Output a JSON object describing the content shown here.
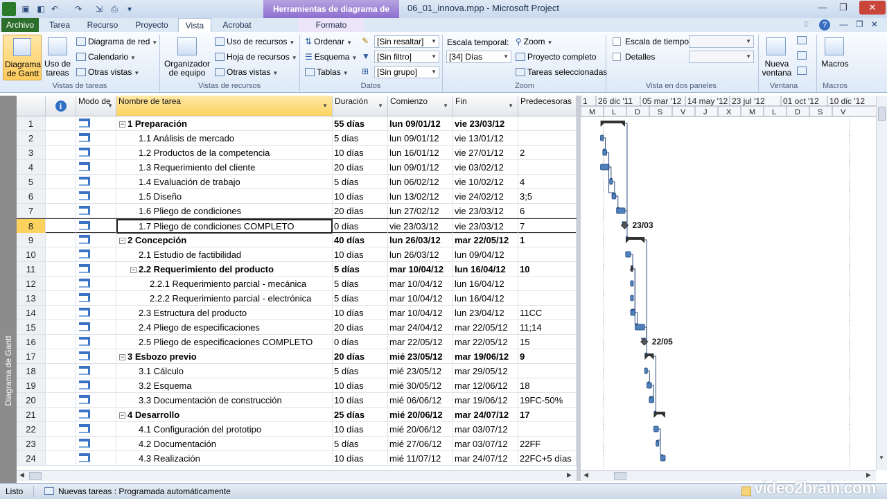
{
  "titlebar": {
    "title": "06_01_innova.mpp  -  Microsoft Project",
    "context_group": "Herramientas de diagrama de Gantt"
  },
  "tabs": [
    "Archivo",
    "Tarea",
    "Recurso",
    "Proyecto",
    "Vista",
    "Acrobat",
    "Formato"
  ],
  "ribbon": {
    "vistas_tareas": {
      "label": "Vistas de tareas",
      "gantt": "Diagrama de Gantt",
      "uso_tareas": "Uso de tareas",
      "diagrama_red": "Diagrama de red",
      "calendario": "Calendario",
      "otras_vistas": "Otras vistas"
    },
    "vistas_recursos": {
      "label": "Vistas de recursos",
      "organizador": "Organizador de equipo",
      "uso_recursos": "Uso de recursos",
      "hoja_recursos": "Hoja de recursos",
      "otras_vistas": "Otras vistas"
    },
    "datos": {
      "label": "Datos",
      "ordenar": "Ordenar",
      "esquema": "Esquema",
      "tablas": "Tablas",
      "resaltar": "[Sin resaltar]",
      "filtro": "[Sin filtro]",
      "grupo": "[Sin grupo]"
    },
    "zoom": {
      "label": "Zoom",
      "escala_label": "Escala temporal:",
      "escala_value": "[34] Días",
      "zoom": "Zoom",
      "proyecto_completo": "Proyecto completo",
      "tareas_seleccionadas": "Tareas seleccionadas"
    },
    "dos_paneles": {
      "label": "Vista en dos paneles",
      "escala_tiempo": "Escala de tiempo",
      "detalles": "Detalles"
    },
    "ventana": {
      "label": "Ventana",
      "nueva_ventana": "Nueva ventana"
    },
    "macros": {
      "label": "Macros",
      "macros": "Macros"
    }
  },
  "sidebar_label": "Diagrama de Gantt",
  "columns": {
    "info": "i",
    "modo": "Modo de",
    "nombre": "Nombre de tarea",
    "duracion": "Duración",
    "comienzo": "Comienzo",
    "fin": "Fin",
    "predecesoras": "Predecesoras"
  },
  "tasks": [
    {
      "id": "1",
      "name": "1 Preparación",
      "dur": "55 días",
      "start": "lun 09/01/12",
      "end": "vie 23/03/12",
      "pred": "",
      "level": 0,
      "summary": true
    },
    {
      "id": "2",
      "name": "1.1 Análisis de mercado",
      "dur": "5 días",
      "start": "lun 09/01/12",
      "end": "vie 13/01/12",
      "pred": "",
      "level": 1,
      "summary": false
    },
    {
      "id": "3",
      "name": "1.2 Productos de la competencia",
      "dur": "10 días",
      "start": "lun 16/01/12",
      "end": "vie 27/01/12",
      "pred": "2",
      "level": 1,
      "summary": false
    },
    {
      "id": "4",
      "name": "1.3 Requerimiento del cliente",
      "dur": "20 días",
      "start": "lun 09/01/12",
      "end": "vie 03/02/12",
      "pred": "",
      "level": 1,
      "summary": false
    },
    {
      "id": "5",
      "name": "1.4 Evaluación de trabajo",
      "dur": "5 días",
      "start": "lun 06/02/12",
      "end": "vie 10/02/12",
      "pred": "4",
      "level": 1,
      "summary": false
    },
    {
      "id": "6",
      "name": "1.5 Diseño",
      "dur": "10 días",
      "start": "lun 13/02/12",
      "end": "vie 24/02/12",
      "pred": "3;5",
      "level": 1,
      "summary": false
    },
    {
      "id": "7",
      "name": "1.6 Pliego de condiciones",
      "dur": "20 días",
      "start": "lun 27/02/12",
      "end": "vie 23/03/12",
      "pred": "6",
      "level": 1,
      "summary": false
    },
    {
      "id": "8",
      "name": "1.7 Pliego de condiciones  COMPLETO",
      "dur": "0 días",
      "start": "vie 23/03/12",
      "end": "vie 23/03/12",
      "pred": "7",
      "level": 1,
      "summary": false,
      "selected": true
    },
    {
      "id": "9",
      "name": "2 Concepción",
      "dur": "40 días",
      "start": "lun 26/03/12",
      "end": "mar 22/05/12",
      "pred": "1",
      "level": 0,
      "summary": true
    },
    {
      "id": "10",
      "name": "2.1 Estudio de factibilidad",
      "dur": "10 días",
      "start": "lun 26/03/12",
      "end": "lun 09/04/12",
      "pred": "",
      "level": 1,
      "summary": false
    },
    {
      "id": "11",
      "name": "2.2 Requerimiento del producto",
      "dur": "5 días",
      "start": "mar 10/04/12",
      "end": "lun 16/04/12",
      "pred": "10",
      "level": 1,
      "summary": true
    },
    {
      "id": "12",
      "name": "2.2.1 Requerimiento parcial - mecánica",
      "dur": "5 días",
      "start": "mar 10/04/12",
      "end": "lun 16/04/12",
      "pred": "",
      "level": 2,
      "summary": false
    },
    {
      "id": "13",
      "name": "2.2.2 Requerimiento parcial - electrónica",
      "dur": "5 días",
      "start": "mar 10/04/12",
      "end": "lun 16/04/12",
      "pred": "",
      "level": 2,
      "summary": false
    },
    {
      "id": "14",
      "name": "2.3 Estructura del producto",
      "dur": "10 días",
      "start": "mar 10/04/12",
      "end": "lun 23/04/12",
      "pred": "11CC",
      "level": 1,
      "summary": false
    },
    {
      "id": "15",
      "name": "2.4 Pliego de especificaciones",
      "dur": "20 días",
      "start": "mar 24/04/12",
      "end": "mar 22/05/12",
      "pred": "11;14",
      "level": 1,
      "summary": false
    },
    {
      "id": "16",
      "name": "2.5 Pliego de especificaciones COMPLETO",
      "dur": "0 días",
      "start": "mar 22/05/12",
      "end": "mar 22/05/12",
      "pred": "15",
      "level": 1,
      "summary": false
    },
    {
      "id": "17",
      "name": "3 Esbozo previo",
      "dur": "20 días",
      "start": "mié 23/05/12",
      "end": "mar 19/06/12",
      "pred": "9",
      "level": 0,
      "summary": true
    },
    {
      "id": "18",
      "name": "3.1 Cálculo",
      "dur": "5 días",
      "start": "mié 23/05/12",
      "end": "mar 29/05/12",
      "pred": "",
      "level": 1,
      "summary": false
    },
    {
      "id": "19",
      "name": "3.2 Esquema",
      "dur": "10 días",
      "start": "mié 30/05/12",
      "end": "mar 12/06/12",
      "pred": "18",
      "level": 1,
      "summary": false
    },
    {
      "id": "20",
      "name": "3.3 Documentación de construcción",
      "dur": "10 días",
      "start": "mié 06/06/12",
      "end": "mar 19/06/12",
      "pred": "19FC-50%",
      "level": 1,
      "summary": false
    },
    {
      "id": "21",
      "name": "4 Desarrollo",
      "dur": "25 días",
      "start": "mié 20/06/12",
      "end": "mar 24/07/12",
      "pred": "17",
      "level": 0,
      "summary": true
    },
    {
      "id": "22",
      "name": "4.1 Configuración del prototipo",
      "dur": "10 días",
      "start": "mié 20/06/12",
      "end": "mar 03/07/12",
      "pred": "",
      "level": 1,
      "summary": false
    },
    {
      "id": "23",
      "name": "4.2 Documentación",
      "dur": "5 días",
      "start": "mié 27/06/12",
      "end": "mar 03/07/12",
      "pred": "22FF",
      "level": 1,
      "summary": false
    },
    {
      "id": "24",
      "name": "4.3 Realización",
      "dur": "10 días",
      "start": "mié 11/07/12",
      "end": "mar 24/07/12",
      "pred": "22FC+5 días",
      "level": 1,
      "summary": false
    }
  ],
  "timescale": {
    "top": [
      "1",
      "26 dic '11",
      "05 mar '12",
      "14 may '12",
      "23 jul '12",
      "01 oct '12",
      "10 dic '12"
    ],
    "bottom": [
      "M",
      "L",
      "D",
      "S",
      "V",
      "J",
      "X",
      "M",
      "L",
      "D",
      "S",
      "V"
    ]
  },
  "milestones": {
    "m1": "23/03",
    "m2": "22/05"
  },
  "status": {
    "ready": "Listo",
    "new_tasks": "Nuevas tareas : Programada automáticamente",
    "watermark": "video2brain.com"
  }
}
